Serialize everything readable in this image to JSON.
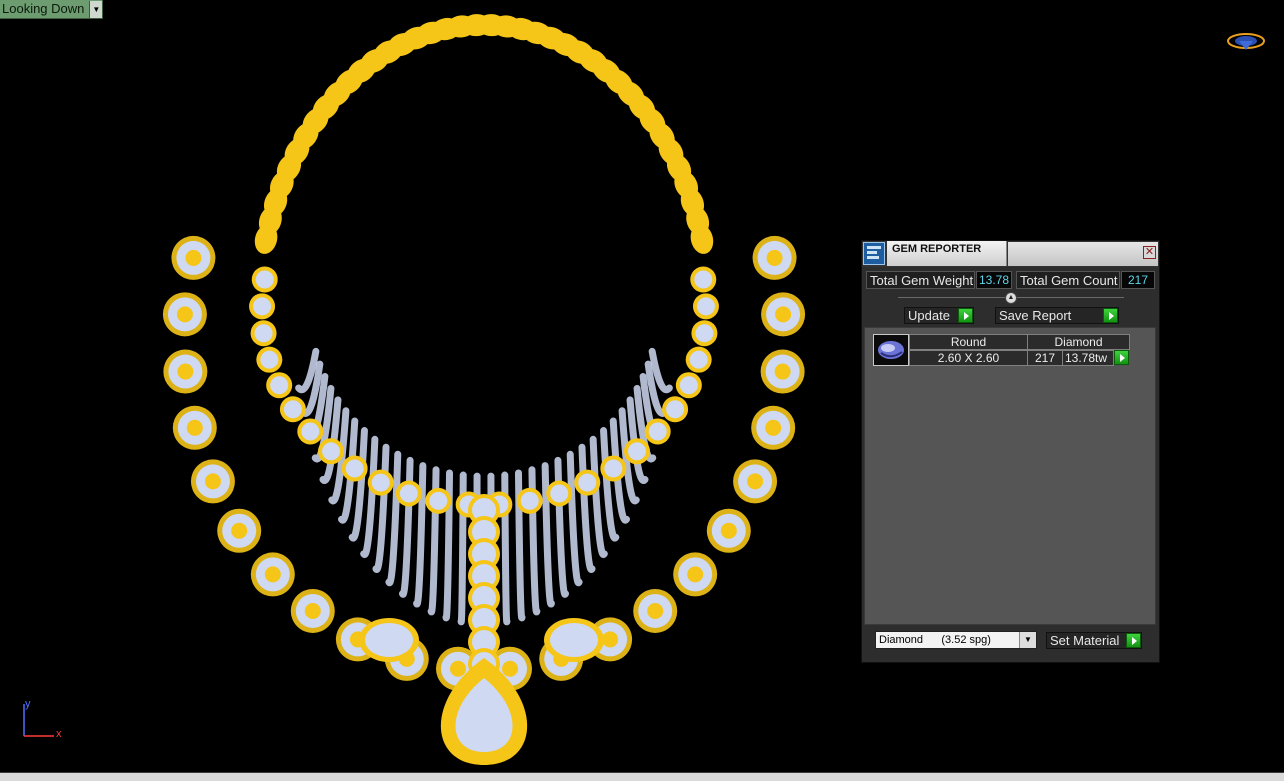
{
  "viewport": {
    "view_name": "Looking Down",
    "view_dropdown_icon": "chevron-down-icon",
    "axis": {
      "y": "y",
      "x": "x"
    }
  },
  "gem_reporter": {
    "title": "GEM REPORTER",
    "close_icon": "close-icon",
    "total_weight_label": "Total Gem Weight",
    "total_weight_value": "13.78",
    "total_count_label": "Total Gem Count",
    "total_count_value": "217",
    "update_label": "Update",
    "save_report_label": "Save Report",
    "table": {
      "headers": [
        "Round",
        "Diamond"
      ],
      "rows": [
        {
          "size": "2.60 X 2.60",
          "count": "217",
          "weight": "13.78tw"
        }
      ]
    },
    "material_select": "Diamond      (3.52 spg)",
    "set_material_label": "Set Material"
  },
  "colors": {
    "gold": "#f5c518",
    "diamond": "#cfd9f2",
    "go_button": "#22b022",
    "value_text": "#5fd3e8"
  }
}
